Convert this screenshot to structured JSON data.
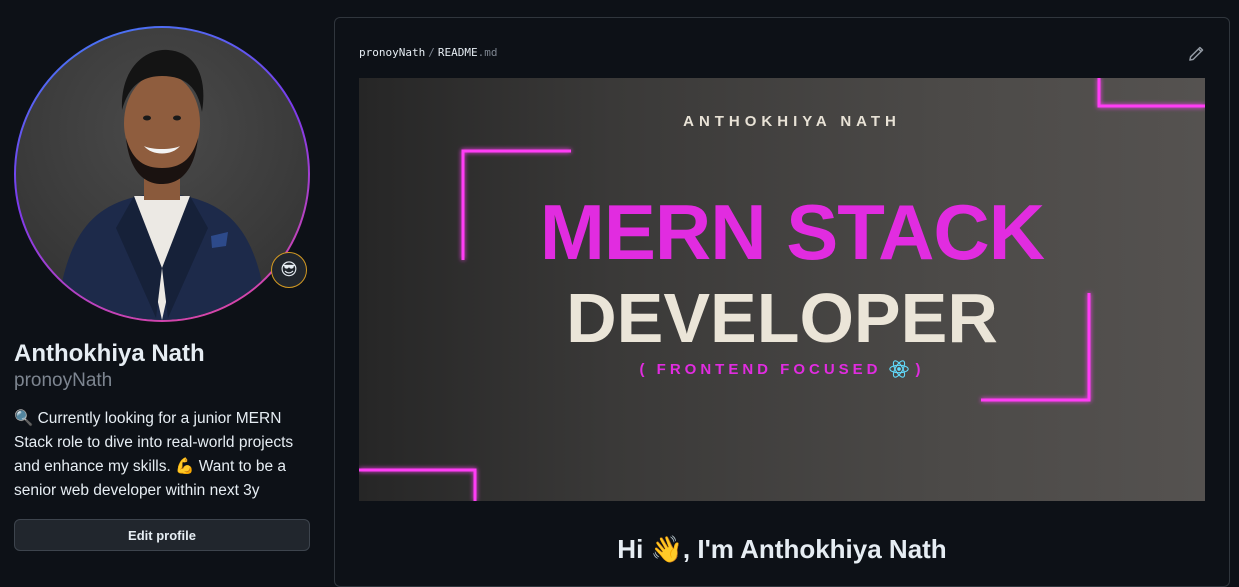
{
  "profile": {
    "name": "Anthokhiya Nath",
    "login": "pronoyNath",
    "status_emoji": "😎",
    "bio": "🔍 Currently looking for a junior MERN Stack role to dive into real-world projects and enhance my skills. 💪 Want to be a senior web developer within next 3y",
    "edit_button": "Edit profile"
  },
  "readme": {
    "user": "pronoyNath",
    "separator": "/",
    "file_name": "README",
    "file_ext": ".md",
    "edit_icon": "pencil-icon",
    "banner": {
      "name": "ANTHOKHIYA NATH",
      "title_line1": "MERN STACK",
      "title_line2": "DEVELOPER",
      "subtitle_open": "( FRONTEND FOCUSED",
      "subtitle_icon": "react-icon",
      "subtitle_close": ")",
      "colors": {
        "neon": "#e12ce0",
        "cream": "#ebe5d8",
        "react": "#61dafb"
      }
    },
    "heading": "Hi 👋, I'm Anthokhiya Nath"
  }
}
